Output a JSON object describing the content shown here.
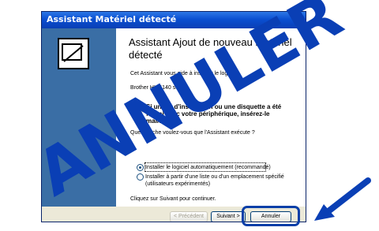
{
  "window": {
    "title": "Assistant Matériel détecté"
  },
  "heading": "Assistant Ajout de nouveau matériel détecté",
  "texts": {
    "intro": "Cet Assistant vous aide à installer le logiciel",
    "device": "Brother HL-5140 series",
    "cd_note": "Si un CD d'installation ou une disquette a été fourni avec votre périphérique, insérez-le maintenant.",
    "question": "Quelle tâche voulez-vous que l'Assistant exécute ?",
    "continue": "Cliquez sur Suivant pour continuer."
  },
  "options": [
    {
      "label": "Installer le logiciel automatiquement (recommandé)",
      "selected": true
    },
    {
      "label": "Installer à partir d'une liste ou d'un emplacement spécifié (utilisateurs expérimentés)",
      "selected": false
    }
  ],
  "buttons": {
    "back": "< Précédent",
    "next": "Suivant >",
    "cancel": "Annuler"
  },
  "stamp": "ANNULER",
  "colors": {
    "stamp": "#0a3fb5",
    "titlebar": "#0a4fd1",
    "sidebar": "#3a6ea5"
  }
}
